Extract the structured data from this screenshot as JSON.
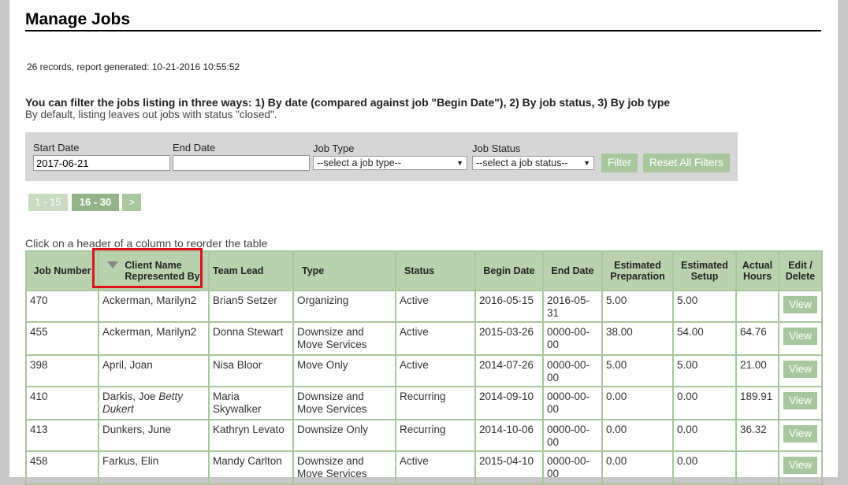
{
  "page_title": "Manage Jobs",
  "records_info": "26 records, report generated: 10-21-2016 10:55:52",
  "filter_info": {
    "line1": "You can filter the jobs listing in three ways: 1) By date (compared against job \"Begin Date\"), 2) By job status, 3) By job type",
    "line2": "By default, listing leaves out jobs with status \"closed\"."
  },
  "filters": {
    "start_date_label": "Start Date",
    "start_date_value": "2017-06-21",
    "end_date_label": "End Date",
    "end_date_value": "",
    "job_type_label": "Job Type",
    "job_type_value": "--select a job type--",
    "job_status_label": "Job Status",
    "job_status_value": "--select a job status--",
    "filter_button": "Filter",
    "reset_button": "Reset All Filters"
  },
  "pagination": {
    "page1": "1 - 15",
    "page2": "16  - 30",
    "next": ">"
  },
  "table_hint": "Click on a header of a column to reorder the table",
  "table": {
    "headers": {
      "job_number": "Job Number",
      "client_name": "Client Name",
      "represented_by": "Represented By",
      "team_lead": "Team Lead",
      "type": "Type",
      "status": "Status",
      "begin_date": "Begin Date",
      "end_date": "End Date",
      "est_prep_1": "Estimated",
      "est_prep_2": "Preparation",
      "est_setup_1": "Estimated",
      "est_setup_2": "Setup",
      "actual_1": "Actual",
      "actual_2": "Hours",
      "edit_1": "Edit /",
      "edit_2": "Delete"
    },
    "view_label": "View",
    "rows": [
      {
        "job": "470",
        "client": "Ackerman,  Marilyn2",
        "rep": "",
        "lead": "Brian5 Setzer",
        "type": "Organizing",
        "status": "Active",
        "begin": "2016-05-15",
        "end": "2016-05-31",
        "prep": "5.00",
        "setup": "5.00",
        "actual": ""
      },
      {
        "job": "455",
        "client": "Ackerman,  Marilyn2",
        "rep": "",
        "lead": "Donna Stewart",
        "type": "Downsize and Move Services",
        "status": "Active",
        "begin": "2015-03-26",
        "end": "0000-00-00",
        "prep": "38.00",
        "setup": "54.00",
        "actual": "64.76"
      },
      {
        "job": "398",
        "client": "April,  Joan",
        "rep": "",
        "lead": "Nisa Bloor",
        "type": "Move Only",
        "status": "Active",
        "begin": "2014-07-26",
        "end": "0000-00-00",
        "prep": "5.00",
        "setup": "5.00",
        "actual": "21.00"
      },
      {
        "job": "410",
        "client": "Darkis, Joe ",
        "rep": "Betty Dukert",
        "lead": "Maria Skywalker",
        "type": "Downsize and Move Services",
        "status": "Recurring",
        "begin": "2014-09-10",
        "end": "0000-00-00",
        "prep": "0.00",
        "setup": "0.00",
        "actual": "189.91"
      },
      {
        "job": "413",
        "client": "Dunkers, June",
        "rep": "",
        "lead": "Kathryn Levato",
        "type": "Downsize Only",
        "status": "Recurring",
        "begin": "2014-10-06",
        "end": "0000-00-00",
        "prep": "0.00",
        "setup": "0.00",
        "actual": "36.32"
      },
      {
        "job": "458",
        "client": "Farkus,  Elin",
        "rep": "",
        "lead": "Mandy Carlton",
        "type": "Downsize and Move Services",
        "status": "Active",
        "begin": "2015-04-10",
        "end": "0000-00-00",
        "prep": "0.00",
        "setup": "0.00",
        "actual": ""
      }
    ]
  },
  "colors": {
    "accent_green": "#a9c79e",
    "header_green": "#b9d2ad",
    "highlight_red": "#e0101b"
  }
}
